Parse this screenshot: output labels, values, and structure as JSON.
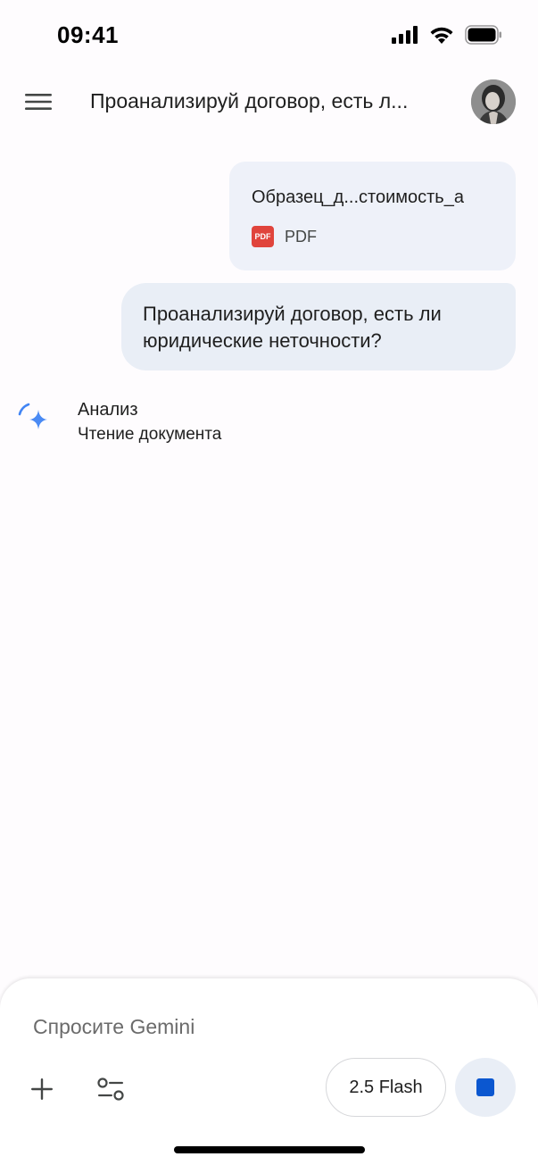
{
  "status_bar": {
    "time": "09:41",
    "icons": [
      "cellular-signal-icon",
      "wifi-icon",
      "battery-icon"
    ]
  },
  "header": {
    "menu_icon": "hamburger-menu-icon",
    "title": "Проанализируй договор, есть л..."
  },
  "attachment": {
    "file_name": "Образец_д...стоимость_а",
    "icon_label": "PDF",
    "file_type": "PDF"
  },
  "user_message": {
    "text": "Проанализируй договор, есть ли юридические неточности?"
  },
  "analysis": {
    "icon": "gemini-sparkle-spinner-icon",
    "title": "Анализ",
    "status": "Чтение документа"
  },
  "composer": {
    "placeholder": "Спросите Gemini",
    "add_icon": "plus-icon",
    "tools_icon": "tools-sliders-icon",
    "model_label": "2.5 Flash",
    "stop_icon": "stop-icon"
  },
  "colors": {
    "accent": "#0b57d0",
    "bubble": "#e9eef6",
    "card": "#eef1f9",
    "pdf_red": "#e0443c"
  }
}
